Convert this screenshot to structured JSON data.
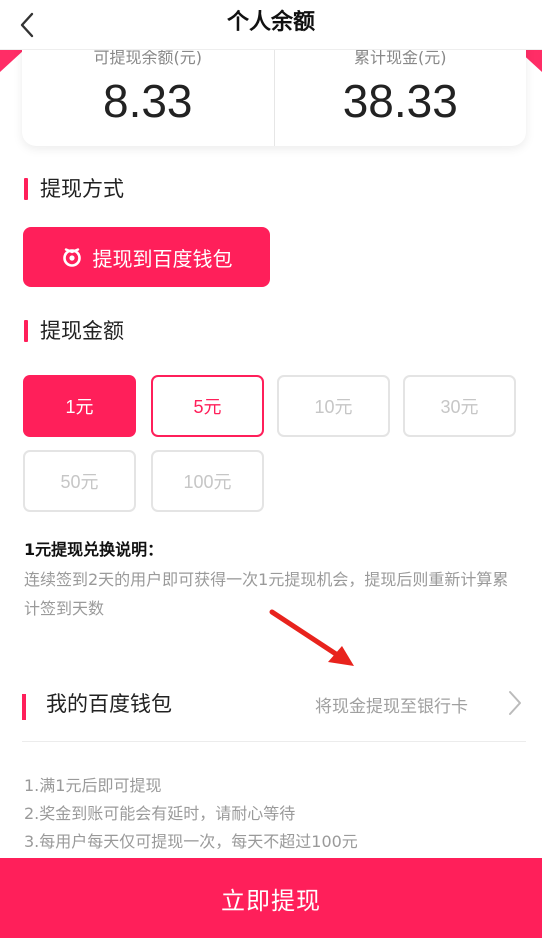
{
  "header": {
    "title": "个人余额"
  },
  "balance": {
    "withdrawable_label": "可提现余额(元)",
    "withdrawable_value": "8.33",
    "total_label": "累计现金(元)",
    "total_value": "38.33"
  },
  "method": {
    "section_title": "提现方式",
    "option_label": "提现到百度钱包"
  },
  "amount": {
    "section_title": "提现金额",
    "options": [
      "1元",
      "5元",
      "10元",
      "30元",
      "50元",
      "100元"
    ]
  },
  "rule": {
    "title": "1元提现兑换说明：",
    "text": "连续签到2天的用户即可获得一次1元提现机会，提现后则重新计算累计签到天数"
  },
  "wallet": {
    "label": "我的百度钱包",
    "hint": "将现金提现至银行卡"
  },
  "notes": [
    "1.满1元后即可提现",
    "2.奖金到账可能会有延时，请耐心等待",
    "3.每用户每天仅可提现一次，每天不超过100元"
  ],
  "submit_label": "立即提现",
  "colors": {
    "accent": "#ff1f5a",
    "muted": "#9a9a9a",
    "arrow": "#e8231d"
  },
  "icons": {
    "back": "chevron-left-icon",
    "wallet": "baidu-wallet-icon",
    "chevron": "chevron-right-icon",
    "annotation": "red-arrow"
  }
}
